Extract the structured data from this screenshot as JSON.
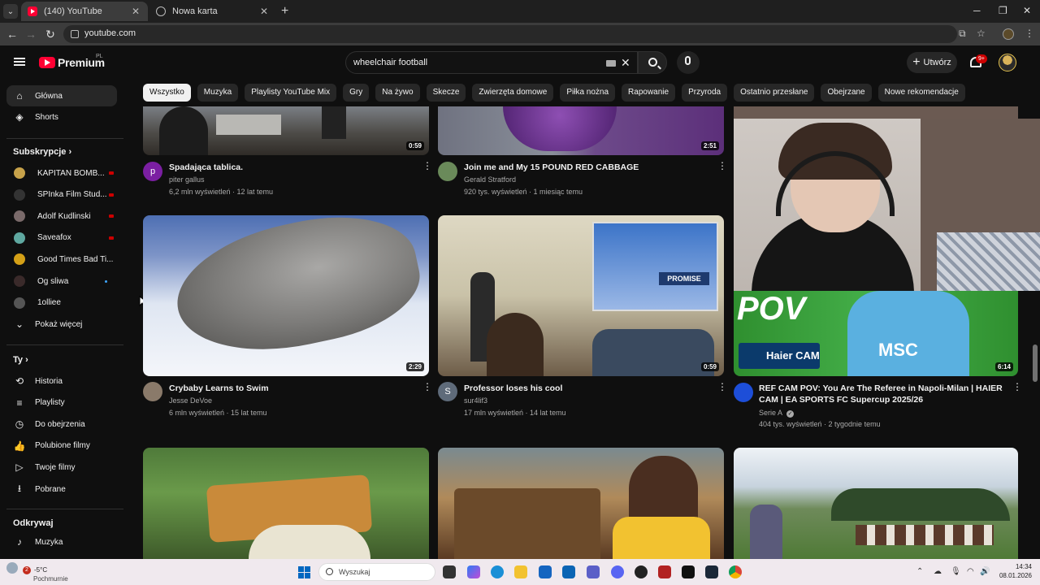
{
  "browser": {
    "tabs": [
      {
        "title": "(140) YouTube",
        "active": true
      },
      {
        "title": "Nowa karta",
        "active": false
      }
    ],
    "url": "youtube.com"
  },
  "youtube": {
    "logo_text": "Premium",
    "region": "PL",
    "search_query": "wheelchair football",
    "create_label": "Utwórz",
    "notif_badge": "9+"
  },
  "chips": [
    "Wszystko",
    "Muzyka",
    "Playlisty YouTube Mix",
    "Gry",
    "Na żywo",
    "Skecze",
    "Zwierzęta domowe",
    "Piłka nożna",
    "Rapowanie",
    "Przyroda",
    "Ostatnio przesłane",
    "Obejrzane",
    "Nowe rekomendacje"
  ],
  "sidebar": {
    "main": [
      {
        "label": "Główna",
        "icon": "home-icon"
      },
      {
        "label": "Shorts",
        "icon": "shorts-icon"
      }
    ],
    "subs_header": "Subskrypcje",
    "subs": [
      {
        "label": "KAPITAN BOMB...",
        "status": "live",
        "color": "#c7a24a"
      },
      {
        "label": "SPInka Film Stud...",
        "status": "live",
        "color": "#333333"
      },
      {
        "label": "Adolf Kudlinski",
        "status": "live",
        "color": "#7a6a6a"
      },
      {
        "label": "Saveafox",
        "status": "live",
        "color": "#5fa8a0"
      },
      {
        "label": "Good Times Bad Ti...",
        "status": "none",
        "color": "#d4a017"
      },
      {
        "label": "Og sliwa",
        "status": "new",
        "color": "#3a2a2a"
      },
      {
        "label": "1olliee",
        "status": "none",
        "color": "#555555"
      }
    ],
    "show_more": "Pokaż więcej",
    "you_header": "Ty",
    "you": [
      {
        "label": "Historia",
        "icon": "history-icon"
      },
      {
        "label": "Playlisty",
        "icon": "playlists-icon"
      },
      {
        "label": "Do obejrzenia",
        "icon": "watch-later-icon"
      },
      {
        "label": "Polubione filmy",
        "icon": "liked-icon"
      },
      {
        "label": "Twoje filmy",
        "icon": "your-videos-icon"
      },
      {
        "label": "Pobrane",
        "icon": "downloads-icon"
      }
    ],
    "explore_header": "Odkrywaj",
    "explore": [
      {
        "label": "Muzyka",
        "icon": "music-icon"
      }
    ]
  },
  "videos": [
    {
      "title": "Spadająca tablica.",
      "channel": "piter gallus",
      "meta": "6,2 mln wyświetleń · 12 lat temu",
      "duration": "0:59",
      "avatar_letter": "p",
      "avatar_color": "#7b1fa2"
    },
    {
      "title": "Join me and My 15 POUND RED CABBAGE",
      "channel": "Gerald Stratford",
      "meta": "920 tys. wyświetleń · 1 miesiąc temu",
      "duration": "2:51",
      "avatar_letter": "",
      "avatar_color": "#6a8a5a"
    },
    {
      "title": "Crybaby Learns to Swim",
      "channel": "Jesse DeVoe",
      "meta": "6 mln wyświetleń · 15 lat temu",
      "duration": "2:29",
      "avatar_letter": "",
      "avatar_color": "#8a7a6a"
    },
    {
      "title": "Professor loses his cool",
      "channel": "sur4lif3",
      "meta": "17 mln wyświetleń · 14 lat temu",
      "duration": "0:59",
      "avatar_letter": "S",
      "avatar_color": "#5f6b7a"
    },
    {
      "title": "REF CAM POV: You Are The Referee in Napoli-Milan | HAIER CAM | EA SPORTS FC Supercup 2025/26",
      "channel": "Serie A",
      "meta": "404 tys. wyświetleń · 2 tygodnie temu",
      "duration": "6:14",
      "avatar_letter": "",
      "avatar_color": "#1d4ed8"
    }
  ],
  "thumb_text": {
    "pov": "POV",
    "haier": "Haier CAM",
    "promise": "PROMISE",
    "msc": "MSC"
  },
  "taskbar": {
    "temp": "-5°C",
    "condition": "Pochmurnie",
    "weather_badge": "2",
    "search_placeholder": "Wyszukaj",
    "time": "14:34",
    "date": "08.01.2026"
  }
}
